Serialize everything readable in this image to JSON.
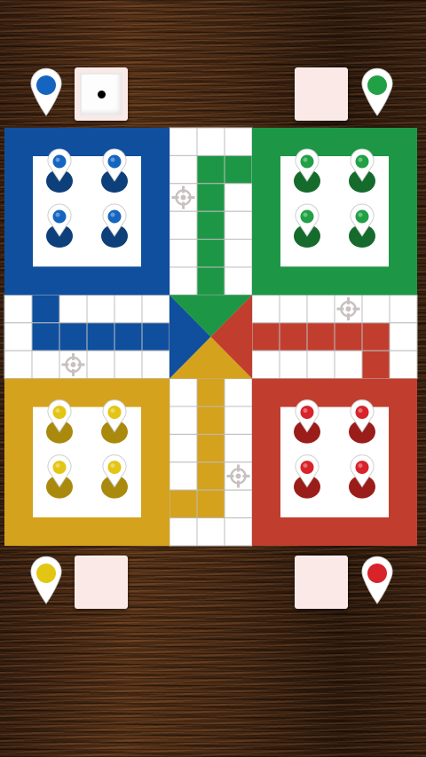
{
  "players": [
    {
      "key": "blue",
      "color": "#1565c0",
      "dark": "#0d3f7a",
      "corner": "top-left"
    },
    {
      "key": "green",
      "color": "#21a045",
      "dark": "#156b2c",
      "corner": "top-right"
    },
    {
      "key": "yellow",
      "color": "#e3c514",
      "dark": "#a98a0d",
      "corner": "bottom-left"
    },
    {
      "key": "red",
      "color": "#d8232a",
      "dark": "#9b1d1a",
      "corner": "bottom-right"
    }
  ],
  "board_colors": {
    "blue": "#0f4f9e",
    "green": "#1d9746",
    "yellow": "#d4a21c",
    "red": "#c13e2f",
    "cell": "#ffffff",
    "grid": "#bcbcbc"
  },
  "dice": [
    {
      "player": "blue",
      "value": 1,
      "active": true
    },
    {
      "player": "green",
      "value": null,
      "active": false
    },
    {
      "player": "yellow",
      "value": null,
      "active": false
    },
    {
      "player": "red",
      "value": null,
      "active": false
    }
  ],
  "icons": {
    "safe_square": "crosshair-star-icon",
    "player_marker": "map-pin-icon",
    "token": "pawn-token-icon"
  }
}
